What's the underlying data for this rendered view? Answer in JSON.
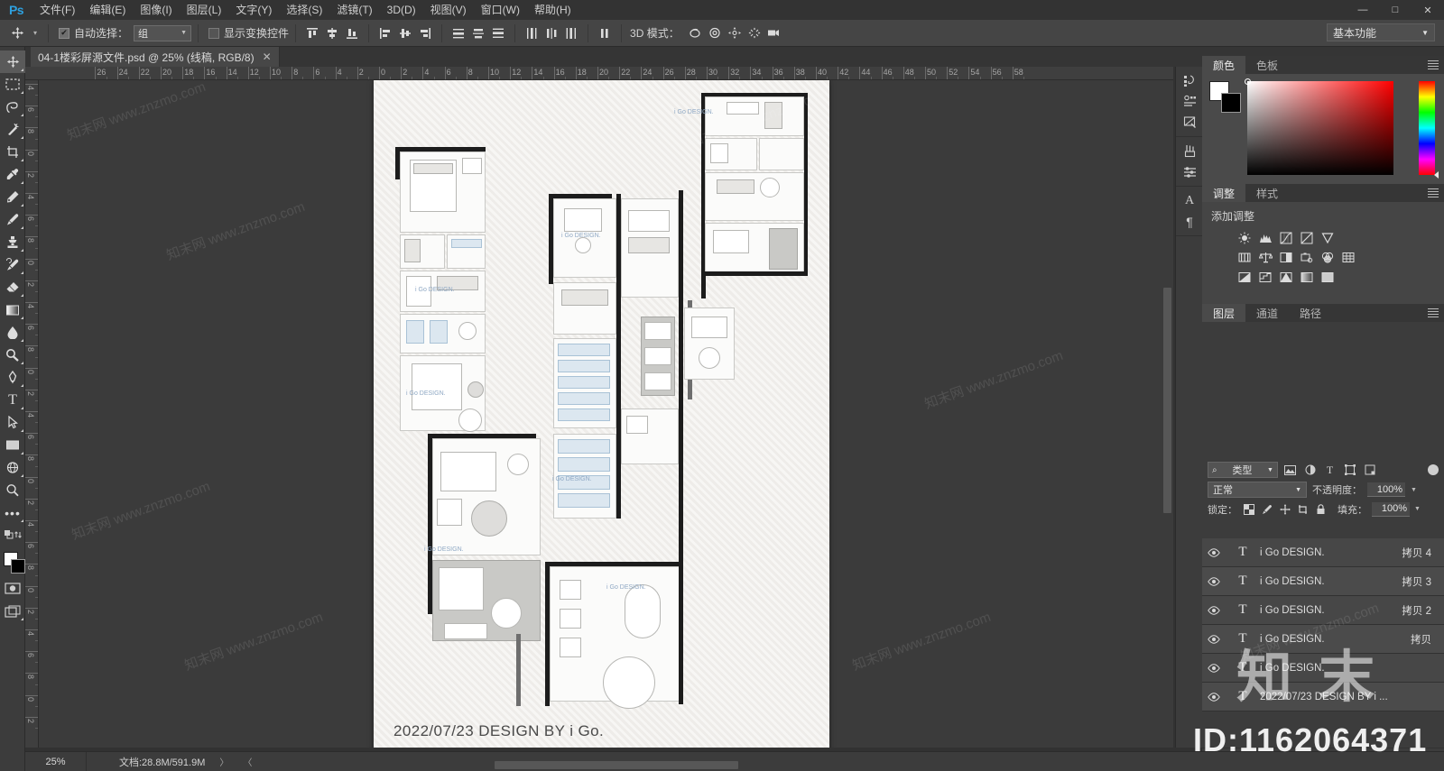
{
  "app": {
    "name": "Ps",
    "logo": "Ps"
  },
  "menubar": {
    "items": [
      {
        "label": "文件(F)",
        "name": "menu-file"
      },
      {
        "label": "编辑(E)",
        "name": "menu-edit"
      },
      {
        "label": "图像(I)",
        "name": "menu-image"
      },
      {
        "label": "图层(L)",
        "name": "menu-layer"
      },
      {
        "label": "文字(Y)",
        "name": "menu-type"
      },
      {
        "label": "选择(S)",
        "name": "menu-select"
      },
      {
        "label": "滤镜(T)",
        "name": "menu-filter"
      },
      {
        "label": "3D(D)",
        "name": "menu-3d"
      },
      {
        "label": "视图(V)",
        "name": "menu-view"
      },
      {
        "label": "窗口(W)",
        "name": "menu-window"
      },
      {
        "label": "帮助(H)",
        "name": "menu-help"
      }
    ],
    "window_controls": {
      "minimize": "—",
      "maximize": "□",
      "close": "✕"
    }
  },
  "options_bar": {
    "tool_icon": "move-tool-icon",
    "auto_select_checked": true,
    "auto_select_label": "自动选择：",
    "auto_select_value": "组",
    "show_transform_label": "显示变换控件",
    "show_transform_checked": false,
    "mode_3d_label": "3D 模式：",
    "workspace": "基本功能"
  },
  "document_tab": {
    "title": "04-1楼彩屏源文件.psd @ 25% (线稿, RGB/8)",
    "close": "✕"
  },
  "toolbar": {
    "tools": [
      {
        "name": "move-tool",
        "active": true
      },
      {
        "name": "rectangular-marquee-tool",
        "active": false
      },
      {
        "name": "lasso-tool",
        "active": false
      },
      {
        "name": "magic-wand-tool",
        "active": false
      },
      {
        "name": "crop-tool",
        "active": false
      },
      {
        "name": "eyedropper-tool",
        "active": false
      },
      {
        "name": "spot-healing-brush-tool",
        "active": false
      },
      {
        "name": "brush-tool",
        "active": false
      },
      {
        "name": "clone-stamp-tool",
        "active": false
      },
      {
        "name": "history-brush-tool",
        "active": false
      },
      {
        "name": "eraser-tool",
        "active": false
      },
      {
        "name": "gradient-tool",
        "active": false
      },
      {
        "name": "blur-tool",
        "active": false
      },
      {
        "name": "dodge-tool",
        "active": false
      },
      {
        "name": "pen-tool",
        "active": false
      },
      {
        "name": "type-tool",
        "active": false
      },
      {
        "name": "path-selection-tool",
        "active": false
      },
      {
        "name": "rectangle-tool",
        "active": false
      },
      {
        "name": "rotate-3d-tool",
        "active": false
      },
      {
        "name": "zoom-tool",
        "active": false
      },
      {
        "name": "edit-toolbar-tool",
        "active": false
      }
    ],
    "foreground_color": "#ffffff",
    "background_color": "#000000"
  },
  "rulers": {
    "h_left_labels": [
      "26",
      "24",
      "22",
      "20",
      "18",
      "16",
      "14",
      "12",
      "10",
      "8",
      "6",
      "4",
      "2"
    ],
    "h_right_labels": [
      "0",
      "2",
      "4",
      "6",
      "8",
      "10",
      "12",
      "14",
      "16",
      "18",
      "20",
      "22",
      "24",
      "26",
      "28",
      "30",
      "32",
      "34",
      "36",
      "38",
      "40",
      "42",
      "44",
      "46",
      "48",
      "50",
      "52",
      "54",
      "56",
      "58"
    ],
    "v_labels": [
      "4",
      "6",
      "8",
      "0",
      "2",
      "4",
      "6",
      "8",
      "0",
      "2",
      "4",
      "6",
      "8",
      "0",
      "2",
      "4",
      "6",
      "8",
      "0",
      "2",
      "4",
      "6",
      "8",
      "0",
      "2",
      "4",
      "6",
      "8",
      "0",
      "2"
    ]
  },
  "canvas": {
    "signature": "2022/07/23 DESIGN BY i Go.",
    "signature_brand": "i Go.",
    "watermarks": [
      "i Go DESIGN.",
      "i Go DESIGN.",
      "i Go DESIGN.",
      "i Go DESIGN.",
      "i Go DESIGN.",
      "i Go DESIGN.",
      "i Go DESIGN.",
      "i Go DESIGN."
    ]
  },
  "dock_rail": {
    "icons": [
      {
        "name": "history-icon"
      },
      {
        "name": "actions-icon"
      },
      {
        "name": "layer-comps-icon"
      },
      {
        "name": "brush-presets-icon"
      },
      {
        "name": "brush-settings-icon"
      },
      {
        "name": "character-icon",
        "glyph": "A"
      },
      {
        "name": "paragraph-icon",
        "glyph": "¶"
      }
    ]
  },
  "color_panel": {
    "tabs": [
      {
        "label": "颜色",
        "active": true,
        "name": "tab-color"
      },
      {
        "label": "色板",
        "active": false,
        "name": "tab-swatches"
      }
    ],
    "foreground": "#ffffff",
    "background": "#000000",
    "field_accent": "#ff0000"
  },
  "adjust_panel": {
    "tabs": [
      {
        "label": "调整",
        "active": true,
        "name": "tab-adjustments"
      },
      {
        "label": "样式",
        "active": false,
        "name": "tab-styles"
      }
    ],
    "title": "添加调整",
    "row1": [
      "brightness-contrast-icon",
      "levels-icon",
      "curves-icon",
      "exposure-icon",
      "vibrance-icon"
    ],
    "row2": [
      "hue-saturation-icon",
      "color-balance-icon",
      "black-white-icon",
      "photo-filter-icon",
      "channel-mixer-icon",
      "color-lookup-icon"
    ],
    "row3": [
      "invert-icon",
      "posterize-icon",
      "threshold-icon",
      "gradient-map-icon",
      "selective-color-icon"
    ]
  },
  "layers_panel": {
    "tabs": [
      {
        "label": "图层",
        "active": true,
        "name": "tab-layers"
      },
      {
        "label": "通道",
        "active": false,
        "name": "tab-channels"
      },
      {
        "label": "路径",
        "active": false,
        "name": "tab-paths"
      }
    ],
    "filter_kind": "类型",
    "filter_icons": [
      "pixel-filter-icon",
      "adjustment-filter-icon",
      "type-filter-icon",
      "shape-filter-icon",
      "smart-object-filter-icon"
    ],
    "blend_mode": "正常",
    "opacity_label": "不透明度：",
    "opacity_value": "100%",
    "lock_label": "锁定：",
    "lock_icons": [
      "lock-transparent-icon",
      "lock-image-icon",
      "lock-position-icon",
      "lock-artboard-icon",
      "lock-all-icon"
    ],
    "fill_label": "填充：",
    "fill_value": "100%",
    "layers": [
      {
        "name": "i Go DESIGN.",
        "suffix": "拷贝 4",
        "visible": true,
        "type": "T"
      },
      {
        "name": "i Go DESIGN.",
        "suffix": "拷贝 3",
        "visible": true,
        "type": "T"
      },
      {
        "name": "i Go DESIGN.",
        "suffix": "拷贝 2",
        "visible": true,
        "type": "T"
      },
      {
        "name": "i Go DESIGN.",
        "suffix": "拷贝",
        "visible": true,
        "type": "T"
      },
      {
        "name": "i Go DESIGN.",
        "suffix": "",
        "visible": true,
        "type": "T"
      },
      {
        "name": "2022/07/23 DESIGN BY i ...",
        "suffix": "",
        "visible": true,
        "type": "T"
      }
    ],
    "bottom_icons": [
      "link-layers-icon",
      "layer-style-icon",
      "layer-mask-icon",
      "new-fill-adjustment-icon",
      "new-group-icon",
      "new-layer-icon",
      "delete-layer-icon"
    ]
  },
  "status_bar": {
    "zoom": "25%",
    "doc_info": "文档:28.8M/591.9M",
    "arrow": "〉"
  },
  "watermarks": {
    "site_text": "知末网 www.znzmo.com",
    "brand": "知 末",
    "id": "ID:1162064371"
  }
}
